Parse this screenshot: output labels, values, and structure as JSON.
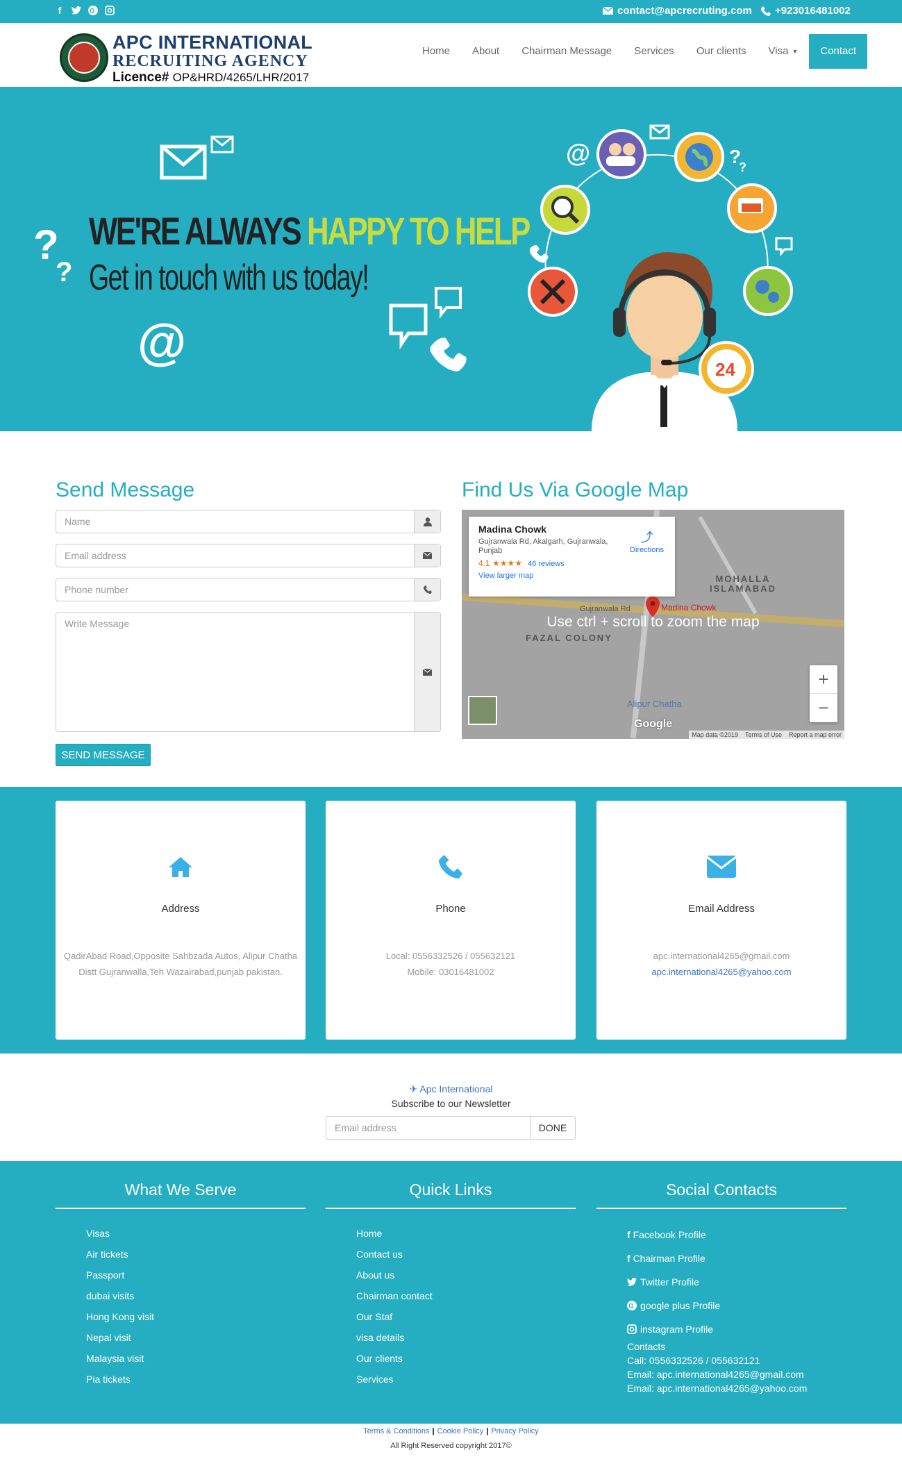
{
  "topbar": {
    "social_icons": [
      "facebook-icon",
      "twitter-icon",
      "google-plus-icon",
      "instagram-icon"
    ],
    "email": "contact@apcrecruting.com",
    "phone": "+923016481002"
  },
  "brand": {
    "line1": "APC INTERNATIONAL",
    "line2": "RECRUITING AGENCY",
    "licence_label": "Licence#",
    "licence_number": "OP&HRD/4265/LHR/2017"
  },
  "nav": {
    "items": [
      "Home",
      "About",
      "Chairman Message",
      "Services",
      "Our clients",
      "Visa",
      "Contact"
    ],
    "active": "Contact"
  },
  "hero": {
    "line1_a": "WE'RE ALWAYS ",
    "line1_b": "HAPPY TO HELP",
    "line2": "Get in touch with us today!",
    "badge": "24"
  },
  "form": {
    "title": "Send Message",
    "name_placeholder": "Name",
    "email_placeholder": "Email address",
    "phone_placeholder": "Phone number",
    "message_placeholder": "Write Message",
    "submit": "SEND MESSAGE"
  },
  "map": {
    "title": "Find Us Via Google Map",
    "place": "Madina Chowk",
    "address": "Gujranwala Rd, Akalgarh, Gujranwala, Punjab",
    "rating": "4.1",
    "stars": "★★★★",
    "reviews": "46 reviews",
    "larger": "View larger map",
    "directions": "Directions",
    "overlay": "Use ctrl + scroll to zoom the map",
    "pin_label": "Madina Chowk",
    "area1": "MOHALLA ISLAMABAD",
    "area2": "FAZAL COLONY",
    "area3": "Alipur Chatha",
    "road": "Gujranwala Rd",
    "footer": [
      "Map data ©2019",
      "Terms of Use",
      "Report a map error"
    ],
    "logo": "Google"
  },
  "info": [
    {
      "icon": "home-icon",
      "title": "Address",
      "lines": [
        "QadirAbad Road,Opposite Sahbzada Autos, Alipur Chatha",
        "Distt Gujranwalla,Teh Wazairabad,punjab pakistan."
      ]
    },
    {
      "icon": "phone-icon",
      "title": "Phone",
      "lines": [
        "Local: 0556332526 / 055632121",
        "Mobile: 03016481002"
      ]
    },
    {
      "icon": "envelope-icon",
      "title": "Email Address",
      "lines": [
        "apc.international4265@gmail.com",
        "apc.international4265@yahoo.com"
      ]
    }
  ],
  "newsletter": {
    "brand": "Apc International",
    "text": "Subscribe to our Newsletter",
    "placeholder": "Email address",
    "button": "DONE"
  },
  "footer": {
    "serve_title": "What We Serve",
    "serve": [
      "Visas",
      "Air tickets",
      "Passport",
      "dubai visits",
      "Hong Kong visit",
      "Nepal visit",
      "Malaysia visit",
      "Pia tickets"
    ],
    "links_title": "Quick Links",
    "links": [
      "Home",
      "Contact us",
      "About us",
      "Chairman contact",
      "Our Staf",
      "visa details",
      "Our clients",
      "Services"
    ],
    "social_title": "Social Contacts",
    "social": [
      "Facebook Profile",
      "Chairman Profile",
      "Twitter Profile",
      "google plus Profile",
      "instagram Profile"
    ],
    "contacts": [
      "Contacts",
      "Call: 0556332526 / 055632121",
      "Email: apc.international4265@gmail.com",
      "Email: apc.international4265@yahoo.com"
    ]
  },
  "copyright": {
    "links": [
      "Terms & Conditions",
      "Cookie Policy",
      "Privacy Policy"
    ],
    "text": "All Right Reserved copyright 2017©"
  },
  "colors": {
    "accent": "#25aec1",
    "brand": "#1c3f6e",
    "highlight": "#c8dc3f"
  }
}
